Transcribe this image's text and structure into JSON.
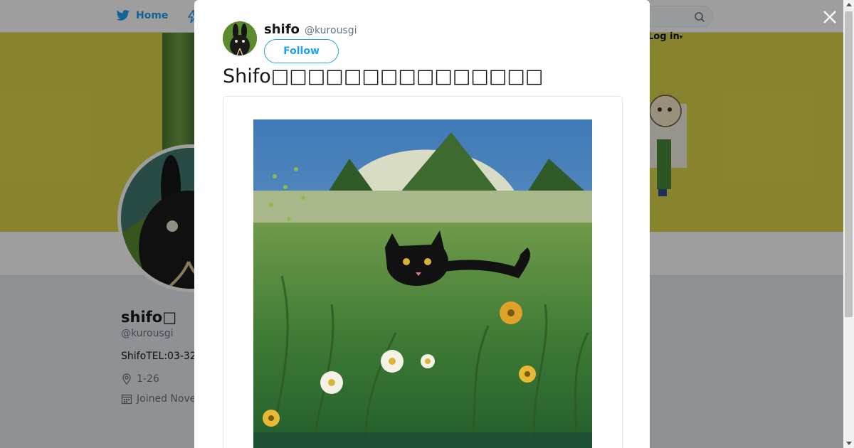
{
  "topnav": {
    "home_label": "Home",
    "login_label": "Log in"
  },
  "profile": {
    "name": "shifo□",
    "handle": "@kurousgi",
    "bio": "ShifoTEL:03-32",
    "location": "1-26",
    "joined": "Joined Nove"
  },
  "tweet": {
    "author_name": "shifo",
    "author_handle": "@kurousgi",
    "follow_label": "Follow",
    "text": "Shifo□□□□□□□□□□□□□□□",
    "media_alt": "painting of a black cat in green grass with flowers and mountains"
  },
  "icons": {
    "brand": "twitter-bird-icon",
    "close": "close-icon",
    "search": "search-icon",
    "location": "location-pin-icon",
    "calendar": "calendar-icon"
  },
  "colors": {
    "accent": "#1da1f2",
    "banner": "#dcd64a",
    "text": "#14171a",
    "muted": "#657786"
  }
}
